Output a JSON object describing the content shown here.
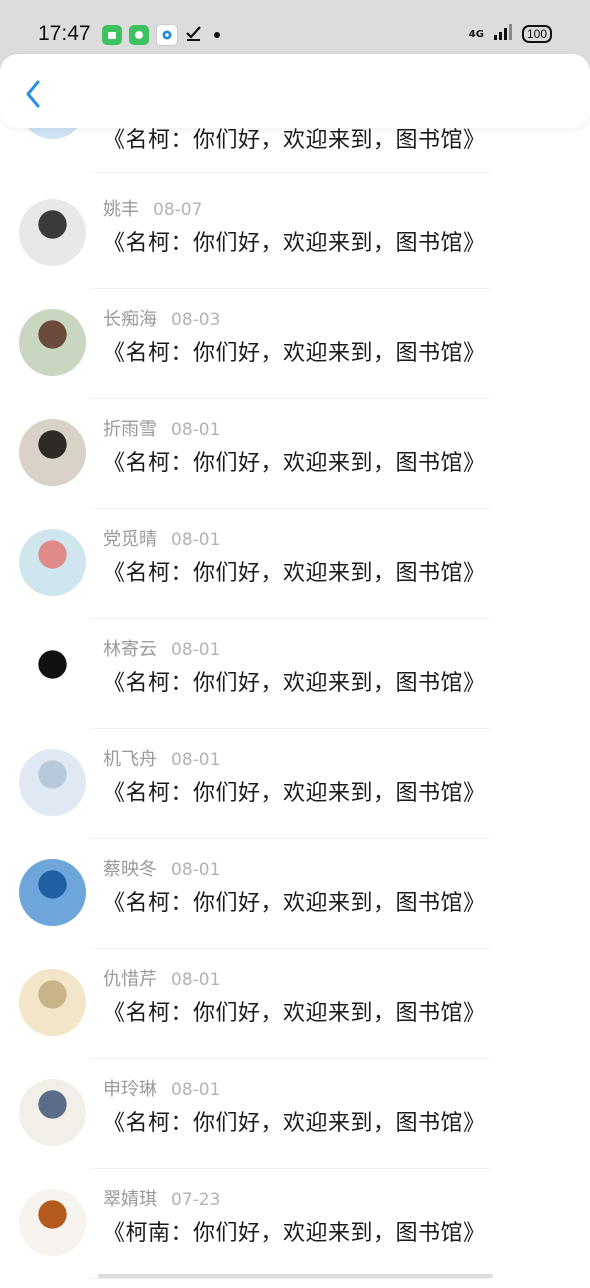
{
  "status_bar": {
    "time": "17:47",
    "network": "4G",
    "battery": "100"
  },
  "header": {
    "back_icon": "chevron-left-icon"
  },
  "messages": [
    {
      "name": "",
      "date": "",
      "text": "《名柯：你们好，欢迎来到，图书馆》",
      "avatar_colors": [
        "#cfe3f5",
        "#7fb3e0"
      ]
    },
    {
      "name": "姚丰",
      "date": "08-07",
      "text": "《名柯：你们好，欢迎来到，图书馆》",
      "avatar_colors": [
        "#e8e8ea",
        "#3a3a3a"
      ]
    },
    {
      "name": "长痴海",
      "date": "08-03",
      "text": "《名柯：你们好，欢迎来到，图书馆》",
      "avatar_colors": [
        "#c9d6c0",
        "#6a4a3a"
      ]
    },
    {
      "name": "折雨雪",
      "date": "08-01",
      "text": "《名柯：你们好，欢迎来到，图书馆》",
      "avatar_colors": [
        "#d8d2c8",
        "#2e2a26"
      ]
    },
    {
      "name": "党觅晴",
      "date": "08-01",
      "text": "《名柯：你们好，欢迎来到，图书馆》",
      "avatar_colors": [
        "#cfe6ee",
        "#e08a8a"
      ]
    },
    {
      "name": "林寄云",
      "date": "08-01",
      "text": "《名柯：你们好，欢迎来到，图书馆》",
      "avatar_colors": [
        "#ffffff",
        "#111111"
      ]
    },
    {
      "name": "机飞舟",
      "date": "08-01",
      "text": "《名柯：你们好，欢迎来到，图书馆》",
      "avatar_colors": [
        "#dfe8f3",
        "#b9c9dc"
      ]
    },
    {
      "name": "蔡映冬",
      "date": "08-01",
      "text": "《名柯：你们好，欢迎来到，图书馆》",
      "avatar_colors": [
        "#6ea6dc",
        "#1f5fa3"
      ]
    },
    {
      "name": "仇惜芹",
      "date": "08-01",
      "text": "《名柯：你们好，欢迎来到，图书馆》",
      "avatar_colors": [
        "#f3e6c8",
        "#c9b48a"
      ]
    },
    {
      "name": "申玲琳",
      "date": "08-01",
      "text": "《名柯：你们好，欢迎来到，图书馆》",
      "avatar_colors": [
        "#f2efe8",
        "#5b6b8a"
      ]
    },
    {
      "name": "翠婧琪",
      "date": "07-23",
      "text": "《柯南：你们好，欢迎来到，图书馆》",
      "avatar_colors": [
        "#f7f3ee",
        "#b55a1e"
      ]
    }
  ]
}
